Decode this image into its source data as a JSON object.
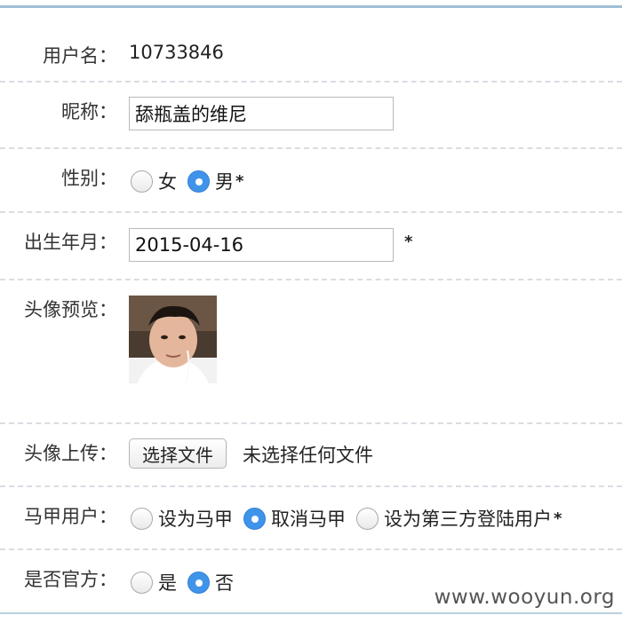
{
  "form": {
    "username": {
      "label": "用户名：",
      "value": "10733846"
    },
    "nickname": {
      "label": "昵称：",
      "value": "舔瓶盖的维尼"
    },
    "gender": {
      "label": "性别：",
      "options": [
        {
          "label": "女",
          "checked": false
        },
        {
          "label": "男",
          "checked": true
        }
      ],
      "required_mark": "*"
    },
    "birthdate": {
      "label": "出生年月：",
      "value": "2015-04-16",
      "required_mark": "*"
    },
    "avatar_preview": {
      "label": "头像预览："
    },
    "avatar_upload": {
      "label": "头像上传：",
      "button_label": "选择文件",
      "status": "未选择任何文件"
    },
    "vest_account": {
      "label": "马甲用户：",
      "options": [
        {
          "label": "设为马甲",
          "checked": false
        },
        {
          "label": "取消马甲",
          "checked": true
        },
        {
          "label": "设为第三方登陆用户",
          "checked": false
        }
      ],
      "required_mark": "*"
    },
    "official": {
      "label": "是否官方：",
      "options": [
        {
          "label": "是",
          "checked": false
        },
        {
          "label": "否",
          "checked": true
        }
      ]
    }
  },
  "watermark": "www.wooyun.org",
  "colors": {
    "accent": "#3f94ea",
    "border_top": "#9fbfd6",
    "separator": "#d9dde2"
  }
}
